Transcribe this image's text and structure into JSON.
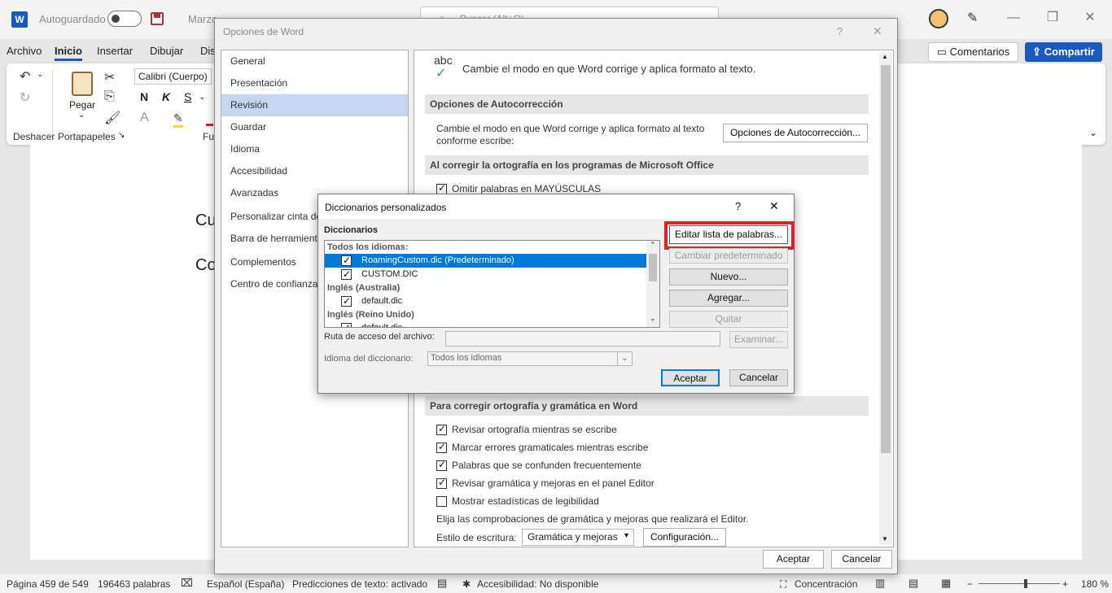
{
  "titlebar": {
    "autosave_label": "Autoguardado",
    "doc_name": "Marzo",
    "search_placeholder": "Buscar (Alt+Q)"
  },
  "ribbon": {
    "tabs": [
      "Archivo",
      "Inicio",
      "Insertar",
      "Dibujar",
      "Dis"
    ],
    "active_tab": "Inicio",
    "font_name": "Calibri (Cuerpo)",
    "paste_label": "Pegar",
    "groups": [
      "Deshacer",
      "Portapapeles",
      "Fu"
    ],
    "format_buttons": [
      "N",
      "K",
      "S"
    ],
    "comments_label": "Comentarios",
    "share_label": "Compartir"
  },
  "document": {
    "visible_fragments": [
      "Cu",
      "Co"
    ]
  },
  "options_dialog": {
    "title": "Opciones de Word",
    "help": "?",
    "close": "✕",
    "nav_items": [
      "General",
      "Presentación",
      "Revisión",
      "Guardar",
      "Idioma",
      "Accesibilidad",
      "Avanzadas",
      "Personalizar cinta de",
      "Barra de herramienta",
      "Complementos",
      "Centro de confianza"
    ],
    "selected_nav": "Revisión",
    "intro_icon_text": "abc",
    "intro_text": "Cambie el modo en que Word corrige y aplica formato al texto.",
    "section_autocorrect": "Opciones de Autocorrección",
    "autocorrect_desc_line1": "Cambie el modo en que Word corrige y aplica formato al texto",
    "autocorrect_desc_line2": "conforme escribe:",
    "autocorrect_button": "Opciones de Autocorrección...",
    "section_office": "Al corregir la ortografía en los programas de Microsoft Office",
    "office_option": "Omitir palabras en MAYÚSCULAS",
    "section_word": "Para corregir ortografía y gramática en Word",
    "word_options": [
      {
        "label": "Revisar ortografía mientras se escribe",
        "checked": true
      },
      {
        "label": "Marcar errores gramaticales mientras escribe",
        "checked": true
      },
      {
        "label": "Palabras que se confunden frecuentemente",
        "checked": true
      },
      {
        "label": "Revisar gramática y mejoras en el panel Editor",
        "checked": true
      },
      {
        "label": "Mostrar estadísticas de legibilidad",
        "checked": false
      }
    ],
    "editor_text": "Elija las comprobaciones de gramática y mejoras que realizará el Editor.",
    "style_label": "Estilo de escritura:",
    "style_value": "Gramática y mejoras",
    "config_button": "Configuración...",
    "ok": "Aceptar",
    "cancel": "Cancelar"
  },
  "dict_dialog": {
    "title": "Diccionarios personalizados",
    "help": "?",
    "close": "✕",
    "list_label": "Diccionarios",
    "rows": [
      {
        "type": "header",
        "text": "Todos los idiomas:"
      },
      {
        "type": "item",
        "text": "RoamingCustom.dic (Predeterminado)",
        "checked": true,
        "selected": true
      },
      {
        "type": "item",
        "text": "CUSTOM.DIC",
        "checked": true,
        "selected": false
      },
      {
        "type": "header",
        "text": "Inglés (Australia)"
      },
      {
        "type": "item",
        "text": "default.dic",
        "checked": true,
        "selected": false
      },
      {
        "type": "header",
        "text": "Inglés (Reino Unido)"
      },
      {
        "type": "item",
        "text": "default.dic",
        "checked": true,
        "selected": false
      }
    ],
    "buttons": {
      "edit": "Editar lista de palabras...",
      "change_default": "Cambiar predeterminado",
      "new": "Nuevo...",
      "add": "Agregar...",
      "remove": "Quitar",
      "browse": "Examinar..."
    },
    "path_label": "Ruta de acceso del archivo:",
    "lang_label": "Idioma del diccionario:",
    "lang_value": "Todos los idiomas",
    "ok": "Aceptar",
    "cancel": "Cancelar",
    "highlight_color": "#d9232d"
  },
  "statusbar": {
    "page": "Página 459 de 549",
    "words": "196463 palabras",
    "language": "Español (España)",
    "predictions": "Predicciones de texto: activado",
    "accessibility": "Accesibilidad: No disponible",
    "focus": "Concentración",
    "zoom": "180 %"
  },
  "colors": {
    "accent": "#185abd",
    "selection": "#0078d7",
    "nav_selected": "#c4d7ee"
  }
}
